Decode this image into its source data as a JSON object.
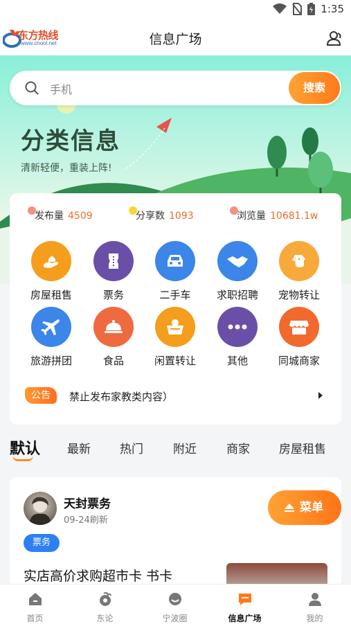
{
  "status_bar": {
    "time": "1:35"
  },
  "app_bar": {
    "logo_text": "东方热线",
    "logo_sub": "www.cnool.net",
    "title": "信息广场"
  },
  "search": {
    "placeholder": "手机",
    "button_label": "搜索"
  },
  "hero": {
    "title": "分类信息",
    "subtitle": "清新轻便，重装上阵!"
  },
  "stats": [
    {
      "label": "发布量",
      "value": "4509",
      "dot_color": "#f07f6d"
    },
    {
      "label": "分享数",
      "value": "1093",
      "dot_color": "#f5d63a"
    },
    {
      "label": "浏览量",
      "value": "10681.1w",
      "dot_color": "#f07f6d"
    }
  ],
  "categories": [
    {
      "label": "房屋租售",
      "icon": "house-hand-icon",
      "color": "#f59d1c"
    },
    {
      "label": "票务",
      "icon": "ticket-icon",
      "color": "#6a4fa8"
    },
    {
      "label": "二手车",
      "icon": "car-icon",
      "color": "#3b86e8"
    },
    {
      "label": "求职招聘",
      "icon": "handshake-icon",
      "color": "#3b86e8"
    },
    {
      "label": "宠物转让",
      "icon": "dog-icon",
      "color": "#f7a93c"
    },
    {
      "label": "旅游拼团",
      "icon": "airplane-icon",
      "color": "#3b86e8"
    },
    {
      "label": "食品",
      "icon": "food-cloche-icon",
      "color": "#ef6a3f"
    },
    {
      "label": "闲置转让",
      "icon": "basket-icon",
      "color": "#f59d1c"
    },
    {
      "label": "其他",
      "icon": "more-dots-icon",
      "color": "#6a4fa8"
    },
    {
      "label": "同城商家",
      "icon": "shop-icon",
      "color": "#f2692e"
    }
  ],
  "notice": {
    "tag": "公告",
    "text": "禁止发布家教类内容）"
  },
  "tabs": [
    "默认",
    "最新",
    "热门",
    "附近",
    "商家",
    "房屋租售"
  ],
  "post": {
    "author": "天封票务",
    "time": "09-24刷新",
    "menu_label": "菜单",
    "tag": "票务",
    "title": "实店高价求购超市卡 书卡"
  },
  "bottom_nav": [
    {
      "label": "首页",
      "icon": "home-icon"
    },
    {
      "label": "东论",
      "icon": "forum-icon"
    },
    {
      "label": "宁波圈",
      "icon": "circle-chat-icon"
    },
    {
      "label": "信息广场",
      "icon": "info-square-icon"
    },
    {
      "label": "我的",
      "icon": "profile-icon"
    }
  ],
  "colors": {
    "accent": "#ff7a1a",
    "blue": "#2e7ff5",
    "hero_top": "#88f0d9"
  }
}
